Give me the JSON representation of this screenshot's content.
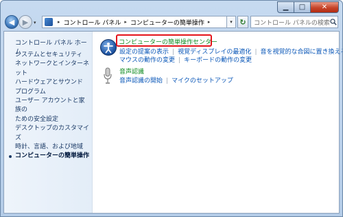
{
  "window": {
    "caption": {
      "minimize": "▁",
      "maximize": "□",
      "close": "✕"
    }
  },
  "nav": {
    "back_glyph": "◀",
    "forward_glyph": "▶",
    "history_glyph": "▾",
    "breadcrumbs": [
      "コントロール パネル",
      "コンピューターの簡単操作"
    ],
    "address_dropdown_glyph": "▾",
    "refresh_glyph": "↻",
    "search_placeholder": "コントロール パネルの検索"
  },
  "sidebar": {
    "home": "コントロール パネル ホーム",
    "items": [
      {
        "label": "システムとセキュリティ"
      },
      {
        "label": "ネットワークとインターネット"
      },
      {
        "label": "ハードウェアとサウンド"
      },
      {
        "label": "プログラム"
      },
      {
        "label": "ユーザー アカウントと家族の"
      },
      {
        "label": "ための安全設定"
      },
      {
        "label": "デスクトップのカスタマイズ"
      },
      {
        "label": "時計、言語、および地域"
      },
      {
        "label": "コンピューターの簡単操作"
      }
    ]
  },
  "main": {
    "category1": {
      "icon": "ease-of-access-icon",
      "title": "コンピューターの簡単操作センター",
      "row1": [
        "設定の提案の表示",
        "視覚ディスプレイの最適化",
        "音を視覚的な合図に置き換える設定"
      ],
      "row2": [
        "マウスの動作の変更",
        "キーボードの動作の変更"
      ]
    },
    "category2": {
      "icon": "microphone-icon",
      "title": "音声認識",
      "row1": [
        "音声認識の開始",
        "マイクのセットアップ"
      ]
    }
  },
  "colors": {
    "frame": "#c6daf0",
    "link": "#0a57b8",
    "category_title": "#0d8a1f",
    "highlight": "#e4141b",
    "sidebar_text": "#1b3a66"
  }
}
